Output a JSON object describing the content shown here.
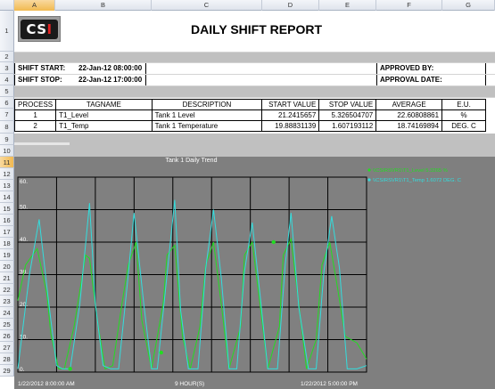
{
  "columns": [
    "A",
    "B",
    "C",
    "D",
    "E",
    "F",
    "G"
  ],
  "rows": [
    "1",
    "2",
    "3",
    "4",
    "5",
    "6",
    "7",
    "8",
    "9",
    "10",
    "11",
    "12",
    "13",
    "14",
    "15",
    "16",
    "17",
    "18",
    "19",
    "20",
    "21",
    "22",
    "23",
    "24",
    "25",
    "26",
    "27",
    "28",
    "29"
  ],
  "logo": {
    "text_c": "CS",
    "text_i": "I"
  },
  "report_title": "DAILY SHIFT REPORT",
  "shift_start_label": "SHIFT START:",
  "shift_start_value": "22-Jan-12 08:00:00",
  "shift_stop_label": "SHIFT STOP:",
  "shift_stop_value": "22-Jan-12 17:00:00",
  "approved_by_label": "APPROVED BY:",
  "approval_date_label": "APPROVAL DATE:",
  "table": {
    "headers": [
      "PROCESS",
      "TAGNAME",
      "DESCRIPTION",
      "START VALUE",
      "STOP VALUE",
      "AVERAGE",
      "E.U."
    ],
    "rows": [
      [
        "1",
        "T1_Level",
        "Tank 1 Level",
        "21.2415657",
        "5.326504707",
        "22.60808861",
        "%"
      ],
      [
        "2",
        "T1_Temp",
        "Tank 1 Temperature",
        "19.88831139",
        "1.607193112",
        "18.74169894",
        "DEG. C"
      ]
    ]
  },
  "chart_data": {
    "type": "line",
    "title": "Tank 1 Daily Trend",
    "x_start_label": "1/22/2012 8:00:00 AM",
    "x_mid_label": "9 HOUR(S)",
    "x_end_label": "1/22/2012 5:00:00 PM",
    "y_ticks": [
      "60.",
      "50.",
      "40.",
      "30.",
      "20.",
      "10.",
      "0."
    ],
    "ylim": [
      0,
      60
    ],
    "xlim_hours": [
      0,
      9
    ],
    "grid": true,
    "legend_placement": "right",
    "series": [
      {
        "name": "\\\\CSIRSVR1\\T1_Level 5.3265 %",
        "color": "#22dd22",
        "x": [
          0,
          0.2,
          0.5,
          0.75,
          0.85,
          1.05,
          1.2,
          1.45,
          1.75,
          1.85,
          2.05,
          2.25,
          2.45,
          2.7,
          2.85,
          3.05,
          3.2,
          3.45,
          3.75,
          3.85,
          4.05,
          4.25,
          4.45,
          4.7,
          4.85,
          5.05,
          5.25,
          5.45,
          5.75,
          5.85,
          6.05,
          6.25,
          6.45,
          6.75,
          6.85,
          7.05,
          7.25,
          7.45,
          7.7,
          7.85,
          8.05,
          8.25,
          8.45,
          8.75,
          9
        ],
        "y": [
          22,
          33,
          38,
          24,
          12,
          1,
          1,
          14,
          36,
          35,
          16,
          1,
          2,
          22,
          33,
          40,
          16,
          1,
          21,
          36,
          39,
          11,
          1,
          14,
          33,
          40,
          21,
          1,
          14,
          36,
          40,
          21,
          1,
          14,
          36,
          41,
          21,
          1,
          10,
          33,
          40,
          26,
          11,
          9,
          4
        ]
      },
      {
        "name": "\\\\CSIRSVR1\\T1_Temp 1.6072 DEG. C",
        "color": "#33dddd",
        "x": [
          0,
          0.3,
          0.55,
          0.8,
          1.0,
          1.15,
          1.35,
          1.6,
          1.85,
          2.0,
          2.2,
          2.4,
          2.6,
          2.85,
          3.0,
          3.25,
          3.45,
          3.6,
          3.85,
          4.05,
          4.2,
          4.4,
          4.65,
          4.85,
          5.05,
          5.25,
          5.45,
          5.65,
          5.85,
          6.05,
          6.25,
          6.45,
          6.7,
          6.9,
          7.05,
          7.25,
          7.5,
          7.7,
          7.9,
          8.1,
          8.3,
          8.5,
          8.75,
          9
        ],
        "y": [
          1,
          30,
          47,
          21,
          2,
          1,
          1,
          21,
          52,
          21,
          2,
          1,
          1,
          30,
          49,
          21,
          1,
          1,
          30,
          53,
          19,
          1,
          1,
          32,
          50,
          29,
          1,
          1,
          31,
          46,
          24,
          1,
          1,
          33,
          49,
          20,
          1,
          1,
          31,
          48,
          32,
          1,
          1,
          2
        ]
      }
    ],
    "markers": [
      {
        "series": 0,
        "x": 1.35,
        "y": 1
      },
      {
        "series": 0,
        "x": 3.7,
        "y": 6
      },
      {
        "series": 0,
        "x": 6.6,
        "y": 40
      }
    ]
  }
}
